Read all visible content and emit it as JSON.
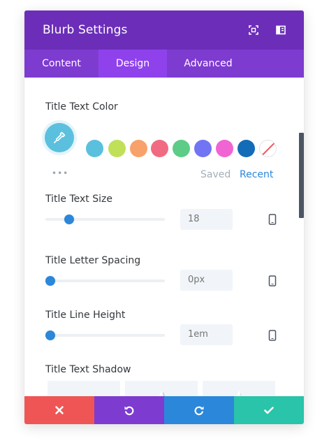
{
  "modal": {
    "title": "Blurb Settings",
    "header_icons": [
      "fullscreen-icon",
      "sidebar-split-icon"
    ]
  },
  "tabs": [
    {
      "label": "Content",
      "active": false
    },
    {
      "label": "Design",
      "active": true
    },
    {
      "label": "Advanced",
      "active": false
    }
  ],
  "title_text_color": {
    "label": "Title Text Color",
    "picker_color": "#5bc0de",
    "more": "•••",
    "swatches": [
      "#5bc0de",
      "#c0e05a",
      "#f8a16b",
      "#f06b82",
      "#5dcc86",
      "#7174f3",
      "#f064d3",
      "#136cb8",
      "none"
    ],
    "tabs": {
      "saved": "Saved",
      "recent": "Recent",
      "active": "recent"
    }
  },
  "title_text_size": {
    "label": "Title Text Size",
    "placeholder": "18",
    "slider_fraction": 0.2
  },
  "title_letter_spacing": {
    "label": "Title Letter Spacing",
    "placeholder": "0px",
    "slider_fraction": 0.0
  },
  "title_line_height": {
    "label": "Title Line Height",
    "placeholder": "1em",
    "slider_fraction": 0.0
  },
  "title_text_shadow": {
    "label": "Title Text Shadow",
    "presets": [
      "none-icon",
      "shadow-preset-1",
      "shadow-preset-2"
    ]
  },
  "footer": {
    "buttons": [
      {
        "name": "cancel",
        "icon": "close-icon",
        "color": "#ef5555"
      },
      {
        "name": "undo",
        "icon": "undo-icon",
        "color": "#7e3bd0"
      },
      {
        "name": "redo",
        "icon": "redo-icon",
        "color": "#2b87da"
      },
      {
        "name": "save",
        "icon": "check-icon",
        "color": "#29c4a9"
      }
    ]
  },
  "colors": {
    "header": "#6c2eb9",
    "tabs": "#7e3bd0",
    "active_tab": "#8f42ec",
    "accent": "#2b87da"
  }
}
